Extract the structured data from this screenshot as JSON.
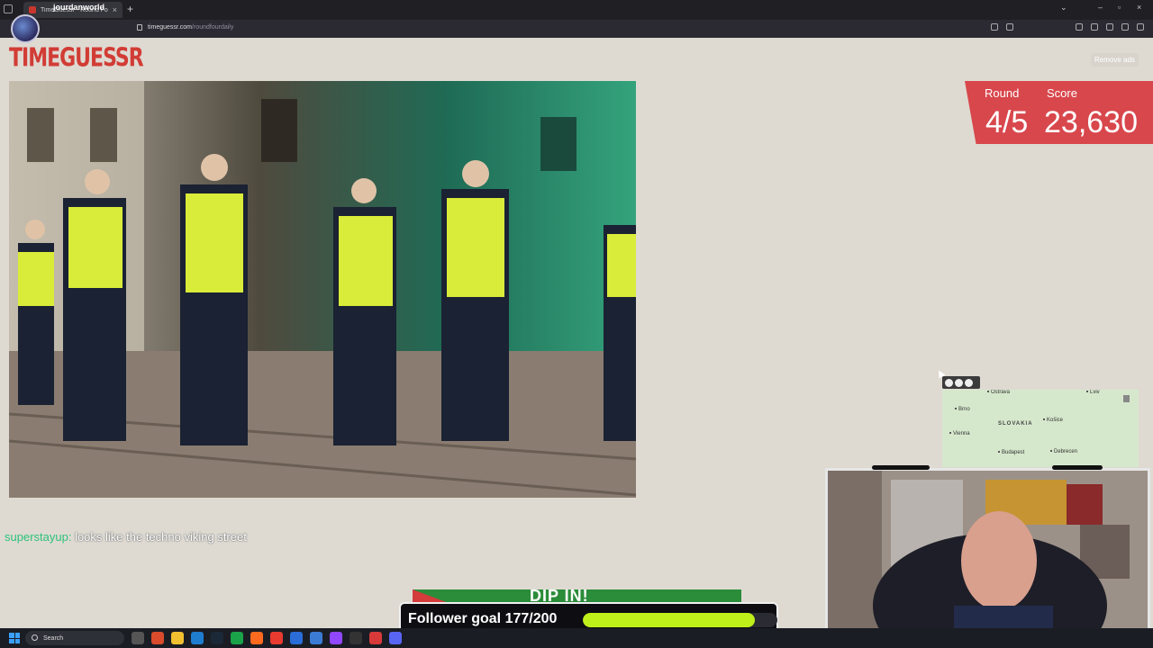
{
  "browser": {
    "tab_title": "TimeGuessr - Round Four",
    "channel_name": "jourdanworld",
    "url_host": "timeguessr.com",
    "url_path": "/roundfourdaily"
  },
  "page": {
    "logo": "TIMEGUESSR",
    "remove_ads": "Remove ads",
    "round_label": "Round",
    "score_label": "Score",
    "round_value": "4/5",
    "score_value": "23,630"
  },
  "map": {
    "cities": [
      "Ostrava",
      "Lviv",
      "Brno",
      "SLOVAKIA",
      "Košice",
      "Vienna",
      "Budapest",
      "Debrecen"
    ]
  },
  "chat": {
    "user": "superstayup:",
    "message": "looks like the techno viking street"
  },
  "overlay": {
    "banner_text": "DIP IN!",
    "follower_label": "Follower goal 177/200",
    "follower_progress": 0.885
  },
  "taskbar": {
    "search_placeholder": "Search"
  },
  "colors": {
    "brand_red": "#d13c35",
    "score_panel": "#d8474c",
    "progress_fill": "#bff01a",
    "chat_user": "#2ec27a"
  }
}
